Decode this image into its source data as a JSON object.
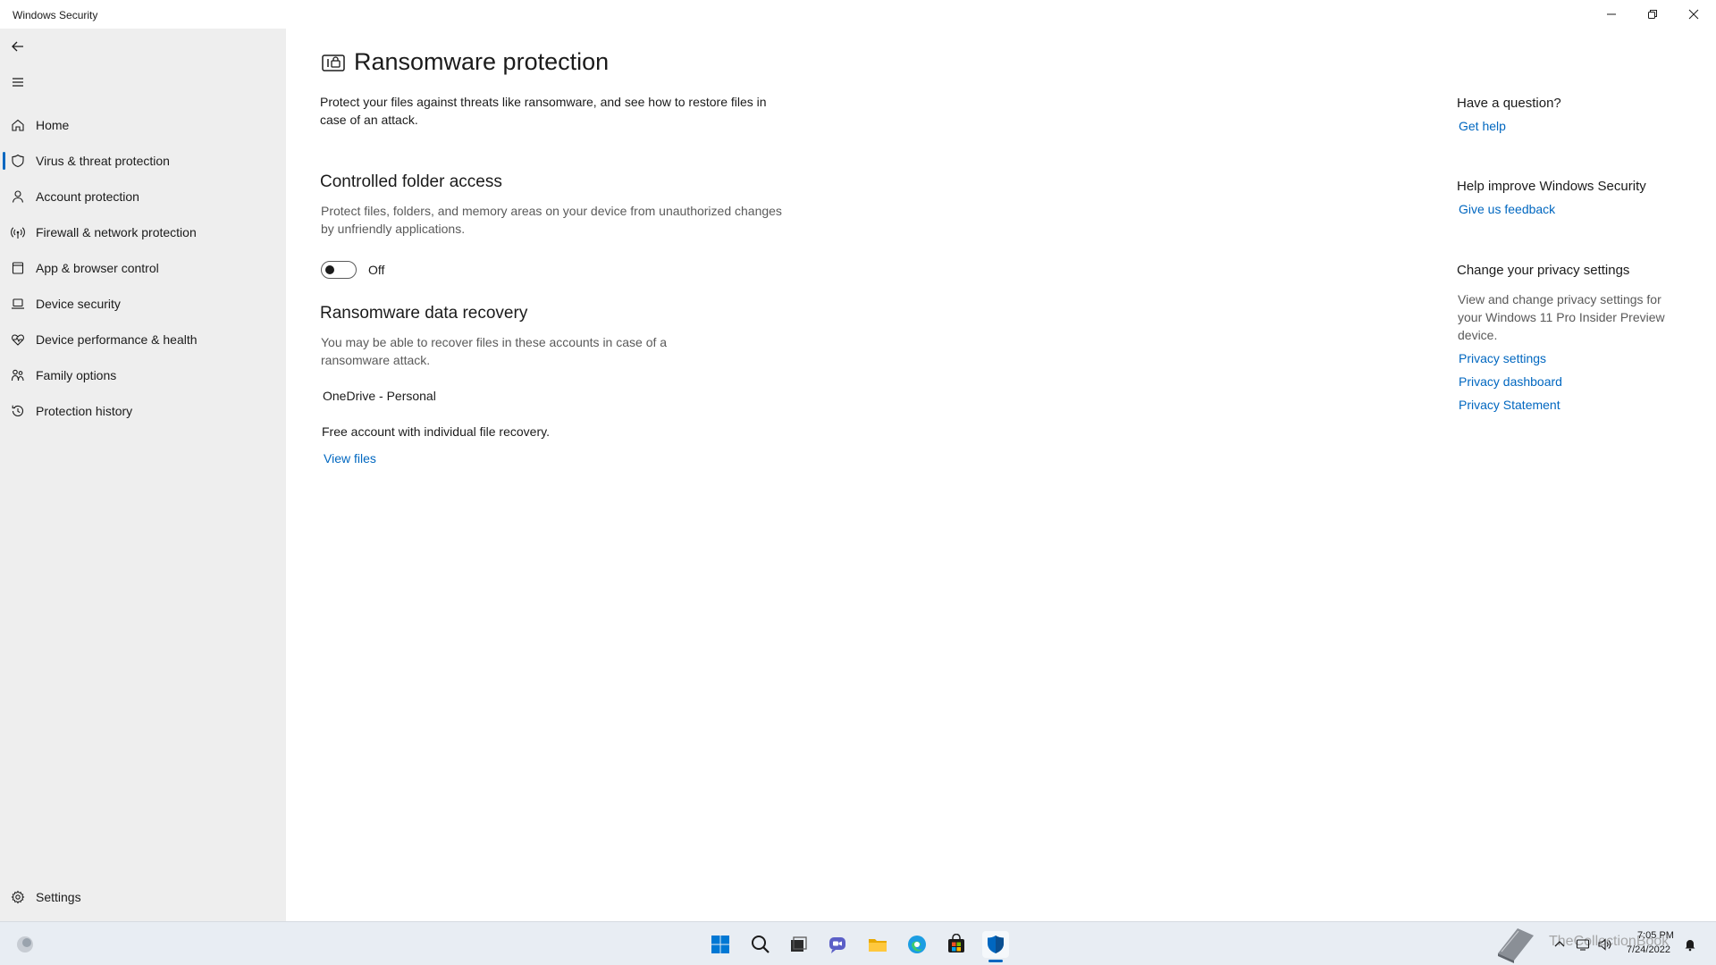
{
  "window": {
    "title": "Windows Security"
  },
  "sidebar": {
    "back_icon": "back-arrow-icon",
    "menu_icon": "hamburger-menu-icon",
    "items": [
      {
        "label": "Home",
        "icon": "home-icon"
      },
      {
        "label": "Virus & threat protection",
        "icon": "shield-icon",
        "active": true
      },
      {
        "label": "Account protection",
        "icon": "person-icon"
      },
      {
        "label": "Firewall & network protection",
        "icon": "wireless-icon"
      },
      {
        "label": "App & browser control",
        "icon": "app-window-icon"
      },
      {
        "label": "Device security",
        "icon": "laptop-icon"
      },
      {
        "label": "Device performance & health",
        "icon": "heart-pulse-icon"
      },
      {
        "label": "Family options",
        "icon": "family-icon"
      },
      {
        "label": "Protection history",
        "icon": "history-icon"
      }
    ],
    "settings_label": "Settings"
  },
  "main": {
    "title": "Ransomware protection",
    "description": "Protect your files against threats like ransomware, and see how to restore files in case of an attack.",
    "controlled_folder": {
      "title": "Controlled folder access",
      "description": "Protect files, folders, and memory areas on your device from unauthorized changes by unfriendly applications.",
      "toggle_state": "Off"
    },
    "recovery": {
      "title": "Ransomware data recovery",
      "description": "You may be able to recover files in these accounts in case of a ransomware attack.",
      "account_name": "OneDrive - Personal",
      "account_detail": "Free account with individual file recovery.",
      "view_files_link": "View files"
    }
  },
  "right_column": {
    "question_title": "Have a question?",
    "get_help_link": "Get help",
    "improve_title": "Help improve Windows Security",
    "feedback_link": "Give us feedback",
    "privacy_title": "Change your privacy settings",
    "privacy_text": "View and change privacy settings for your Windows 11 Pro Insider Preview device.",
    "privacy_settings_link": "Privacy settings",
    "privacy_dashboard_link": "Privacy dashboard",
    "privacy_statement_link": "Privacy Statement"
  },
  "taskbar": {
    "apps": [
      "start-icon",
      "search-icon",
      "task-view-icon",
      "chat-icon",
      "file-explorer-icon",
      "edge-icon",
      "store-icon",
      "windows-security-icon"
    ],
    "active_app": "windows-security-icon",
    "clock_time": "7:05 PM",
    "clock_date": "7/24/2022",
    "watermark": "TheCollectionBook"
  },
  "colors": {
    "accent": "#0067c0",
    "sidebar_bg": "#eeeeee",
    "taskbar_bg": "#e8edf3"
  }
}
